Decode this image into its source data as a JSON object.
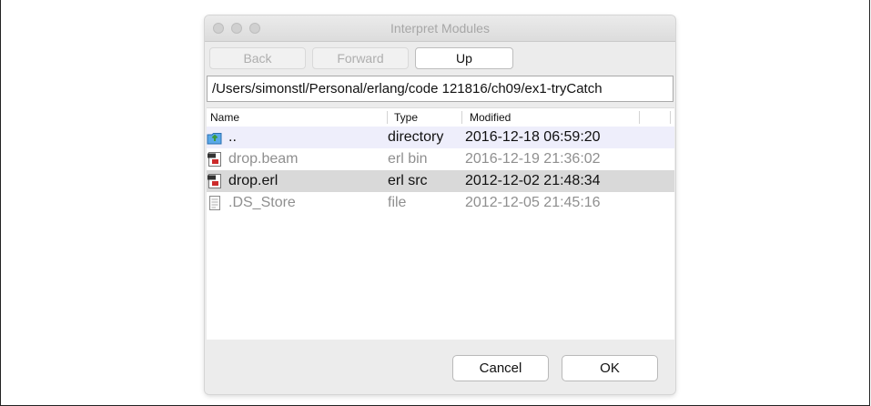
{
  "window": {
    "title": "Interpret Modules"
  },
  "nav": {
    "back": "Back",
    "forward": "Forward",
    "up": "Up"
  },
  "path": "/Users/simonstl/Personal/erlang/code 121816/ch09/ex1-tryCatch",
  "columns": [
    "Name",
    "Type",
    "Modified"
  ],
  "rows": [
    {
      "icon": "folder-up-icon",
      "name": "..",
      "type": "directory",
      "modified": "2016-12-18 06:59:20",
      "state": "highlighted"
    },
    {
      "icon": "beam-file-icon",
      "name": "drop.beam",
      "type": "erl bin",
      "modified": "2016-12-19 21:36:02",
      "state": "dim"
    },
    {
      "icon": "erl-file-icon",
      "name": "drop.erl",
      "type": "erl src",
      "modified": "2012-12-02 21:48:34",
      "state": "selected"
    },
    {
      "icon": "document-icon",
      "name": ".DS_Store",
      "type": "file",
      "modified": "2012-12-05 21:45:16",
      "state": "dim"
    }
  ],
  "buttons": {
    "cancel": "Cancel",
    "ok": "OK"
  },
  "colors": {
    "highlight_row": "#eeeefb",
    "selected_row": "#d9d9d9"
  }
}
